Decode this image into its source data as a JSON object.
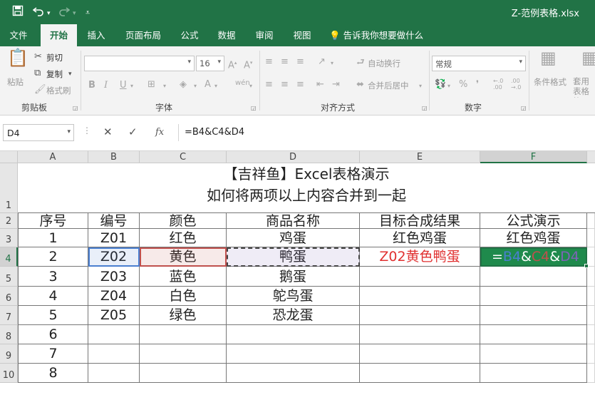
{
  "title_bar": {
    "save_icon": "save-icon",
    "undo_icon": "undo-icon",
    "redo_icon": "redo-icon",
    "customize_icon": "customize-qat-icon",
    "document_title": "Z-范例表格.xlsx"
  },
  "tabs": [
    "文件",
    "开始",
    "插入",
    "页面布局",
    "公式",
    "数据",
    "审阅",
    "视图"
  ],
  "active_tab": "开始",
  "tell_me": "告诉我你想要做什么",
  "ribbon": {
    "clipboard": {
      "paste": "粘贴",
      "cut": "剪切",
      "copy": "复制",
      "format_painter": "格式刷",
      "label": "剪贴板"
    },
    "font": {
      "font_name": "",
      "font_size": "16",
      "bold": "B",
      "italic": "I",
      "underline": "U",
      "label": "字体"
    },
    "alignment": {
      "wrap": "自动换行",
      "merge": "合并后居中",
      "label": "对齐方式"
    },
    "number": {
      "format": "常规",
      "percent": "%",
      "label": "数字"
    },
    "styles": {
      "conditional": "条件格式",
      "table_format": "套用表格格"
    }
  },
  "formula_bar": {
    "name_box": "D4",
    "cancel_icon": "cancel-icon",
    "enter_icon": "check-icon",
    "fx": "fx",
    "formula": "=B4&C4&D4"
  },
  "sheet": {
    "columns": [
      "A",
      "B",
      "C",
      "D",
      "E",
      "F"
    ],
    "selected_column": "F",
    "rows": [
      "1",
      "2",
      "3",
      "4",
      "5",
      "6",
      "7",
      "8",
      "9",
      "10"
    ],
    "selected_row": "4",
    "title_line1": "【吉祥鱼】Excel表格演示",
    "title_line2": "如何将两项以上内容合并到一起",
    "headers": [
      "序号",
      "编号",
      "颜色",
      "商品名称",
      "目标合成结果",
      "公式演示"
    ],
    "data": [
      [
        "1",
        "Z01",
        "红色",
        "鸡蛋",
        "红色鸡蛋",
        "红色鸡蛋"
      ],
      [
        "2",
        "Z02",
        "黄色",
        "鸭蛋",
        "Z02黄色鸭蛋",
        ""
      ],
      [
        "3",
        "Z03",
        "蓝色",
        "鹅蛋",
        "",
        ""
      ],
      [
        "4",
        "Z04",
        "白色",
        "鸵鸟蛋",
        "",
        ""
      ],
      [
        "5",
        "Z05",
        "绿色",
        "恐龙蛋",
        "",
        ""
      ],
      [
        "6",
        "",
        "",
        "",
        "",
        ""
      ],
      [
        "7",
        "",
        "",
        "",
        "",
        ""
      ],
      [
        "8",
        "",
        "",
        "",
        "",
        ""
      ]
    ],
    "edit_formula": {
      "eq": "=",
      "ref1": "B4",
      "amp1": "&",
      "ref2": "C4",
      "amp2": "&",
      "ref3": "D4"
    },
    "colors": {
      "excel_green": "#217346",
      "ref_b": "#4a7fd0",
      "ref_c": "#c0504d",
      "ref_d": "#7e63b8",
      "target_red": "#e03030"
    }
  }
}
